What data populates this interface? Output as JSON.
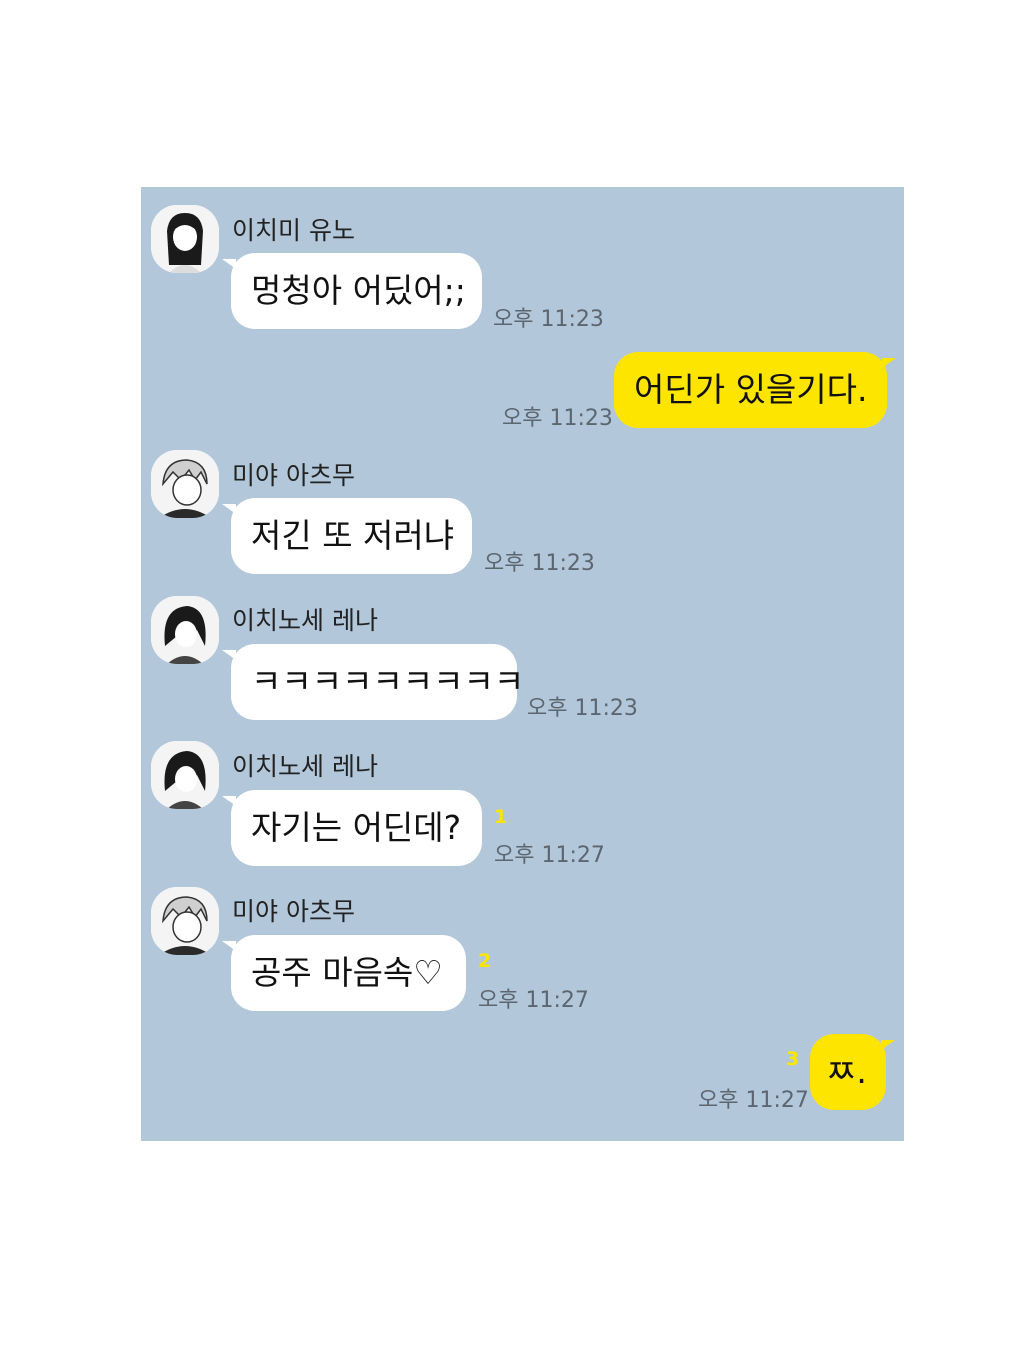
{
  "colors": {
    "chat_bg": "#b2c7da",
    "sent_bubble": "#fee500",
    "recv_bubble": "#ffffff",
    "unread": "#fee500"
  },
  "messages": [
    {
      "sender": "이치미 유노",
      "text": "멍청아 어딨어;;",
      "time": "오후 11:23",
      "avatar": "girl-long-hair-avatar-icon"
    },
    {
      "text": "어딘가 있을기다.",
      "time": "오후 11:23"
    },
    {
      "sender": "미야 아츠무",
      "text": "저긴 또 저러냐",
      "time": "오후 11:23",
      "avatar": "blond-boy-avatar-icon"
    },
    {
      "sender": "이치노세 레나",
      "text": "ㅋㅋㅋㅋㅋㅋㅋㅋㅋ",
      "time": "오후 11:23",
      "avatar": "dark-hair-avatar-icon"
    },
    {
      "sender": "이치노세 레나",
      "text": "자기는 어딘데?",
      "time": "오후 11:27",
      "unread": "1",
      "avatar": "dark-hair-avatar-icon"
    },
    {
      "sender": "미야 아츠무",
      "text": "공주 마음속♡",
      "time": "오후 11:27",
      "unread": "2",
      "avatar": "blond-boy-avatar-icon"
    },
    {
      "text": "ㅉ.",
      "time": "오후 11:27",
      "unread": "3"
    }
  ]
}
